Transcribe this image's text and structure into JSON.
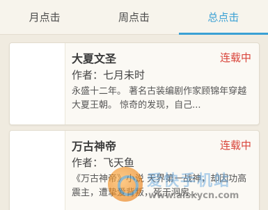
{
  "tabs": [
    {
      "label": "月点击",
      "active": false
    },
    {
      "label": "周点击",
      "active": false
    },
    {
      "label": "总点击",
      "active": true
    }
  ],
  "books": [
    {
      "title": "大夏文圣",
      "status": "连载中",
      "author": "作者：七月未时",
      "description": "永盛十二年。 著名古装编剧作家顾锦年穿越大夏王朝。 惊奇的发现，自己..."
    },
    {
      "title": "万古神帝",
      "status": "连载中",
      "author": "作者：飞天鱼",
      "description": "《万古神帝》小说 天界第一战神，却因功高震主，遭挚爱背叛，死于洞房..."
    }
  ],
  "watermark": {
    "title": "爱快手机站",
    "url": "www.aiskycn.com"
  },
  "colors": {
    "accent": "#3aa0d4",
    "status": "#d9443a",
    "background": "#f0ebe0"
  }
}
